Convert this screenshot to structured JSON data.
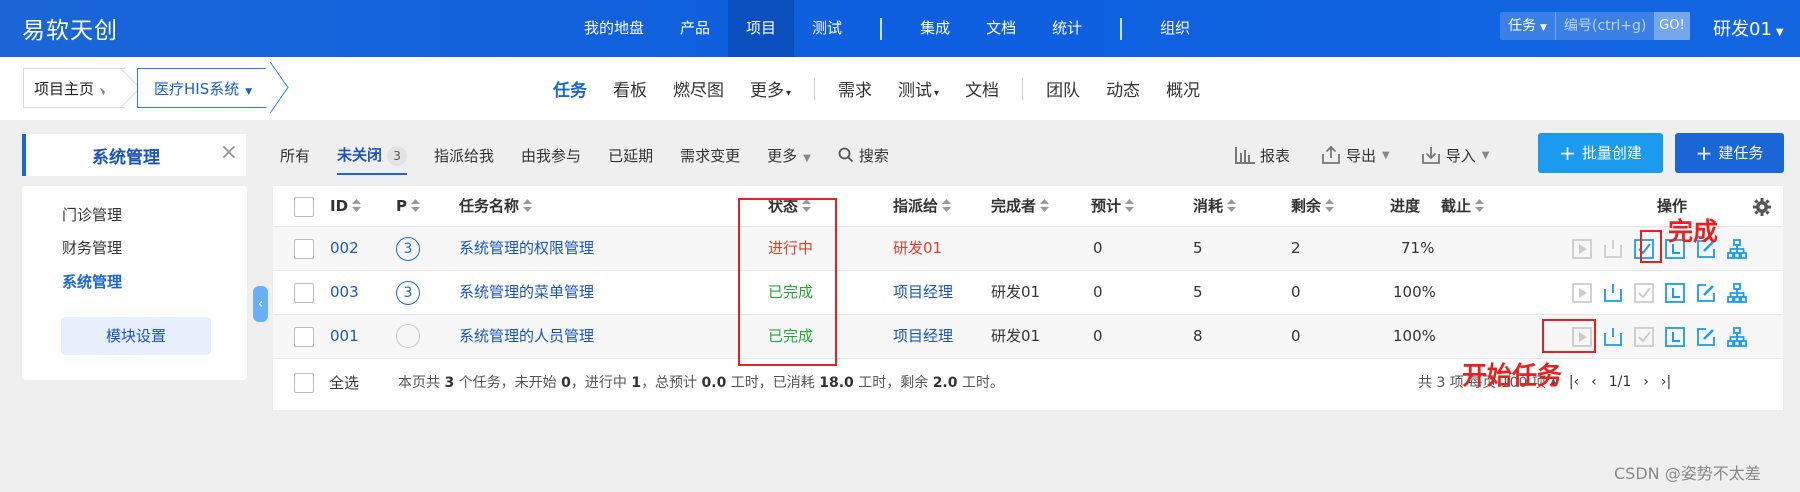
{
  "colors": {
    "primary": "#1a66d6",
    "accent": "#1a9bf0",
    "status_doing": "#e0402a",
    "status_done": "#26a53a",
    "annotation": "#e52222"
  },
  "topbar": {
    "brand": "易软天创",
    "nav": [
      "我的地盘",
      "产品",
      "项目",
      "测试",
      "集成",
      "文档",
      "统计",
      "组织"
    ],
    "active_nav": "项目",
    "search_type": "任务",
    "search_placeholder": "编号(ctrl+g)",
    "go_label": "GO!",
    "user": "研发01"
  },
  "subnav": {
    "crumb_home": "项目主页",
    "crumb_project": "医疗HIS系统",
    "tabs": [
      "任务",
      "看板",
      "燃尽图",
      "更多",
      "需求",
      "测试",
      "文档",
      "团队",
      "动态",
      "概况"
    ],
    "active_tab": "任务"
  },
  "side": {
    "title": "系统管理",
    "items": [
      "门诊管理",
      "财务管理",
      "系统管理"
    ],
    "active_item": "系统管理",
    "module_button": "模块设置"
  },
  "filters": {
    "all": "所有",
    "open": "未关闭",
    "open_count": "3",
    "assigned": "指派给我",
    "involved": "由我参与",
    "delayed": "已延期",
    "story_changed": "需求变更",
    "more": "更多",
    "search": "搜索"
  },
  "tools": {
    "report": "报表",
    "export": "导出",
    "import": "导入",
    "batch_create": "批量创建",
    "create": "建任务"
  },
  "table": {
    "headers": {
      "id": "ID",
      "p": "P",
      "name": "任务名称",
      "status": "状态",
      "assigned_to": "指派给",
      "finished_by": "完成者",
      "estimate": "预计",
      "consumed": "消耗",
      "left": "剩余",
      "progress": "进度",
      "deadline": "截止",
      "actions": "操作"
    },
    "rows": [
      {
        "id": "002",
        "pri": "3",
        "name": "系统管理的权限管理",
        "status": "进行中",
        "assigned_to": "研发01",
        "finished_by": "",
        "estimate": "0",
        "consumed": "5",
        "left": "2",
        "progress": "71%",
        "deadline": ""
      },
      {
        "id": "003",
        "pri": "3",
        "name": "系统管理的菜单管理",
        "status": "已完成",
        "assigned_to": "项目经理",
        "finished_by": "研发01",
        "estimate": "0",
        "consumed": "5",
        "left": "0",
        "progress": "100%",
        "deadline": ""
      },
      {
        "id": "001",
        "pri": "",
        "name": "系统管理的人员管理",
        "status": "已完成",
        "assigned_to": "项目经理",
        "finished_by": "研发01",
        "estimate": "0",
        "consumed": "8",
        "left": "0",
        "progress": "100%",
        "deadline": ""
      }
    ]
  },
  "footer": {
    "select_all": "全选",
    "summary_parts": [
      "本页共 ",
      "3",
      " 个任务，未开始 ",
      "0",
      "，进行中 ",
      "1",
      "，总预计 ",
      "0.0",
      " 工时，已消耗 ",
      "18.0",
      " 工时，剩余 ",
      "2.0",
      " 工时。"
    ],
    "pager_text": "共 3 项 每页 100 项",
    "page": "1/1"
  },
  "annotations": {
    "finish": "完成",
    "start_task": "开始任务"
  },
  "watermark": "CSDN @姿势不太差"
}
